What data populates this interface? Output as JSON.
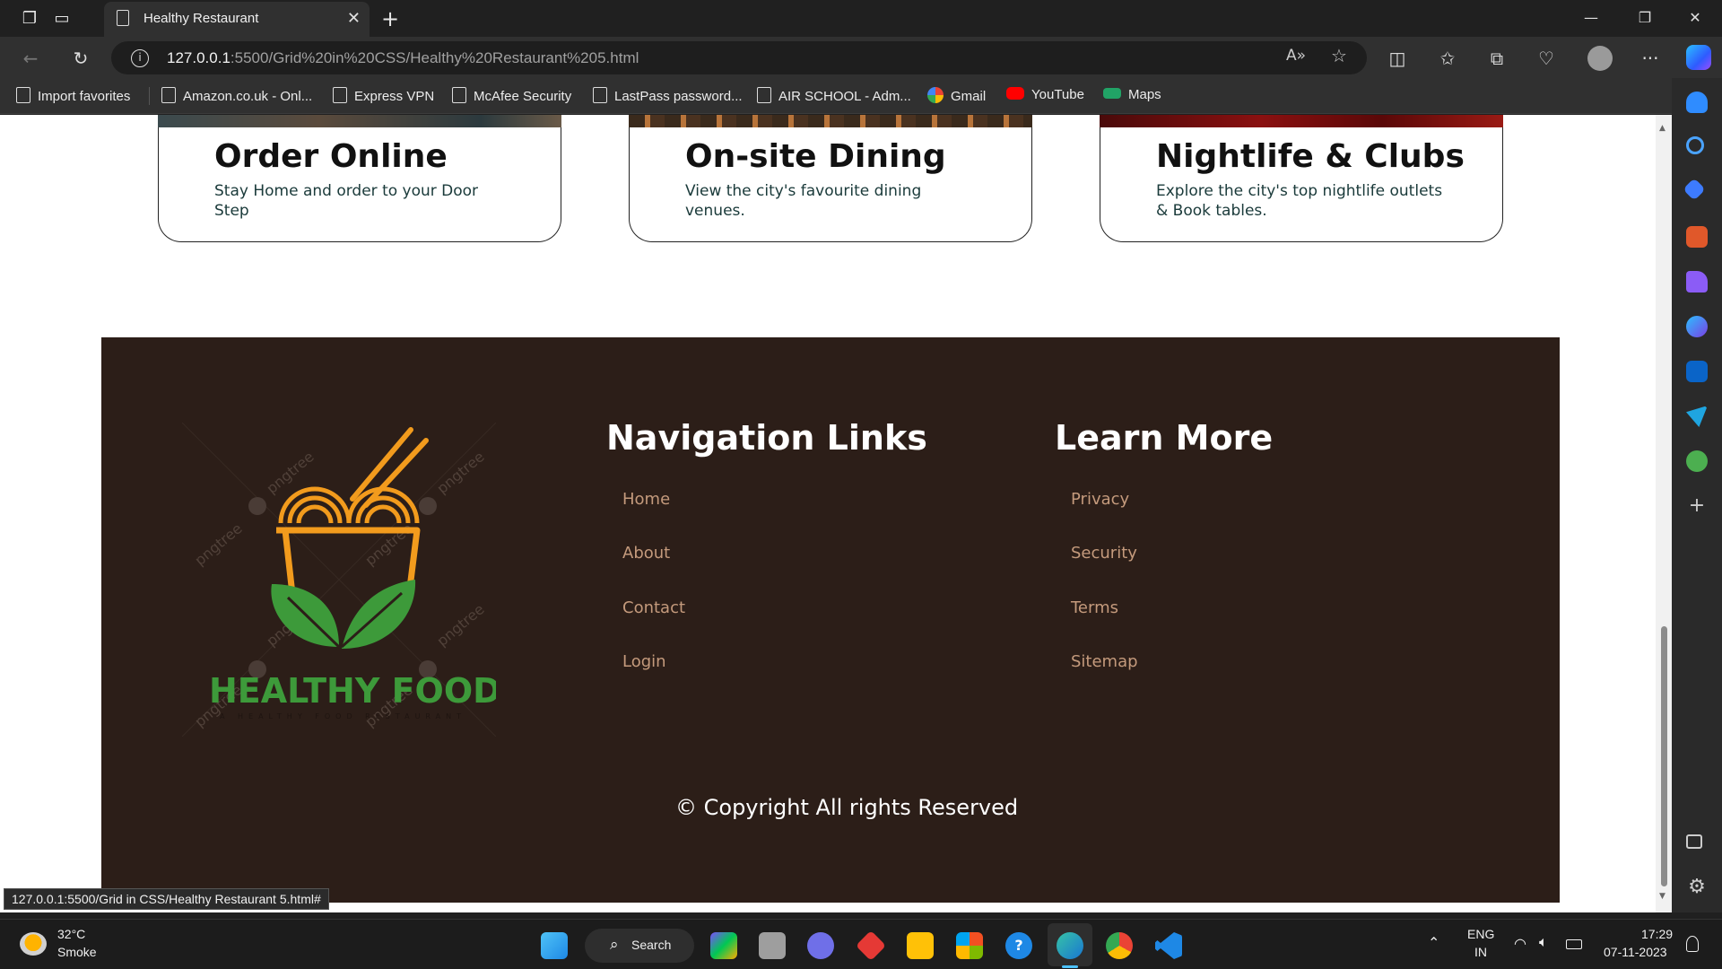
{
  "browser": {
    "tab_title": "Healthy Restaurant",
    "url_host": "127.0.0.1",
    "url_rest": ":5500/Grid%20in%20CSS/Healthy%20Restaurant%205.html",
    "favorites": [
      {
        "label": "Import favorites",
        "icon": "import-icon"
      },
      {
        "label": "Amazon.co.uk - Onl...",
        "icon": "page-icon"
      },
      {
        "label": "Express VPN",
        "icon": "page-icon"
      },
      {
        "label": "McAfee Security",
        "icon": "page-icon"
      },
      {
        "label": "LastPass password...",
        "icon": "page-icon"
      },
      {
        "label": "AIR SCHOOL - Adm...",
        "icon": "page-icon"
      },
      {
        "label": "Gmail",
        "icon": "google-icon"
      },
      {
        "label": "YouTube",
        "icon": "youtube-icon"
      },
      {
        "label": "Maps",
        "icon": "maps-icon"
      }
    ],
    "status_link": "127.0.0.1:5500/Grid in CSS/Healthy Restaurant 5.html#"
  },
  "cards": [
    {
      "title": "Order Online",
      "text": "Stay Home and order to your Door Step"
    },
    {
      "title": "On-site Dining",
      "text": "View the city's favourite dining venues."
    },
    {
      "title": "Nightlife & Clubs",
      "text": "Explore the city's top nightlife outlets & Book tables."
    }
  ],
  "footer": {
    "logo_text": "HEALTHY FOOD",
    "logo_tagline": "A HEALTHY FOOD RESTAURANT",
    "watermark": "pngtree",
    "nav_heading": "Navigation Links",
    "nav_links": [
      "Home",
      "About",
      "Contact",
      "Login"
    ],
    "learn_heading": "Learn More",
    "learn_links": [
      "Privacy",
      "Security",
      "Terms",
      "Sitemap"
    ],
    "copyright": "© Copyright All rights Reserved"
  },
  "taskbar": {
    "weather_temp": "32°C",
    "weather_desc": "Smoke",
    "search_label": "Search",
    "lang_top": "ENG",
    "lang_bottom": "IN",
    "time": "17:29",
    "date": "07-11-2023"
  },
  "colors": {
    "footer_bg": "#2c1e18",
    "link_color": "#c49a7c",
    "logo_green": "#3d9a3a",
    "logo_orange": "#f29b1d"
  }
}
